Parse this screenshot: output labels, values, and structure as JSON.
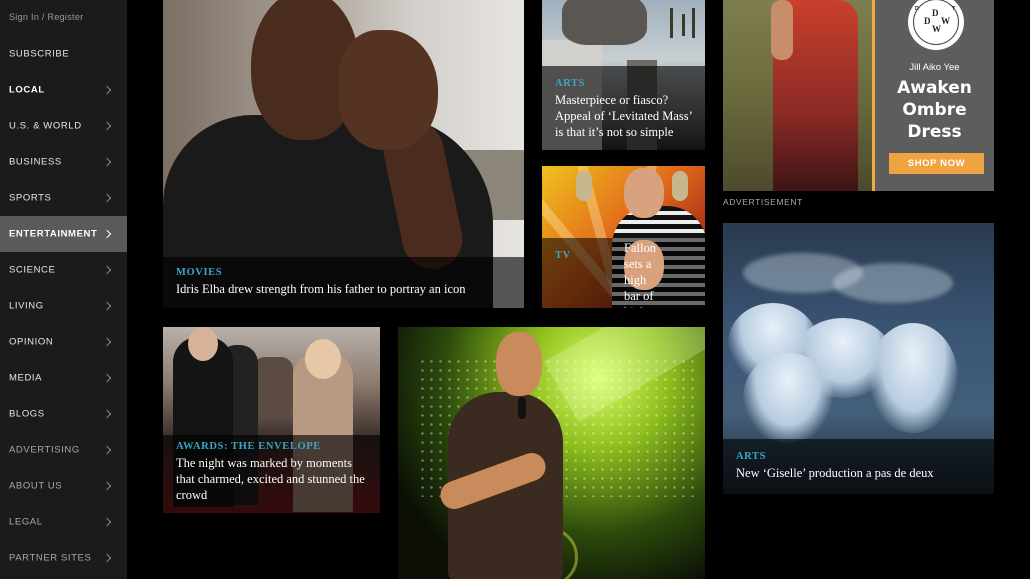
{
  "sidebar": {
    "signin": "Sign In / Register",
    "items": [
      {
        "label": "SUBSCRIBE",
        "chevron": false,
        "style": "normal"
      },
      {
        "label": "LOCAL",
        "chevron": true,
        "style": "bold"
      },
      {
        "label": "U.S. & WORLD",
        "chevron": true,
        "style": "normal"
      },
      {
        "label": "BUSINESS",
        "chevron": true,
        "style": "normal"
      },
      {
        "label": "SPORTS",
        "chevron": true,
        "style": "normal"
      },
      {
        "label": "ENTERTAINMENT",
        "chevron": true,
        "style": "active"
      },
      {
        "label": "SCIENCE",
        "chevron": true,
        "style": "normal"
      },
      {
        "label": "LIVING",
        "chevron": true,
        "style": "normal"
      },
      {
        "label": "OPINION",
        "chevron": true,
        "style": "normal"
      },
      {
        "label": "MEDIA",
        "chevron": true,
        "style": "normal"
      },
      {
        "label": "BLOGS",
        "chevron": true,
        "style": "normal"
      },
      {
        "label": "ADVERTISING",
        "chevron": true,
        "style": "muted"
      },
      {
        "label": "ABOUT US",
        "chevron": true,
        "style": "muted"
      },
      {
        "label": "LEGAL",
        "chevron": true,
        "style": "muted"
      },
      {
        "label": "PARTNER SITES",
        "chevron": true,
        "style": "muted"
      }
    ]
  },
  "stories": {
    "elba": {
      "section": "MOVIES",
      "headline": "Idris Elba drew strength from his father to portray an icon"
    },
    "levitated": {
      "section": "ARTS",
      "headline": "Masterpiece or fiasco? Appeal of ‘Levitated Mass’ is that it’s not so simple"
    },
    "fallon": {
      "section": "TV",
      "headline": "Fallon sets a high bar of high jinks"
    },
    "awards": {
      "section": "AWARDS: THE ENVELOPE",
      "headline": "The night was marked by moments that charmed, excited and stunned the crowd"
    },
    "giselle": {
      "section": "ARTS",
      "headline": "New ‘Giselle’ production a pas de deux"
    }
  },
  "ad": {
    "logo_letters": {
      "top": "D",
      "left": "D",
      "right": "W",
      "bottom": "W"
    },
    "logo_small_left": "D",
    "logo_small_right": "T",
    "brand": "Jill Aiko Yee",
    "line1": "Awaken",
    "line2": "Ombre",
    "line3": "Dress",
    "cta": "SHOP NOW",
    "label": "ADVERTISEMENT"
  },
  "colors": {
    "accent_section": "#3aa6c9",
    "ad_cta": "#f0a341",
    "sidebar_active": "#5a5a5a"
  }
}
